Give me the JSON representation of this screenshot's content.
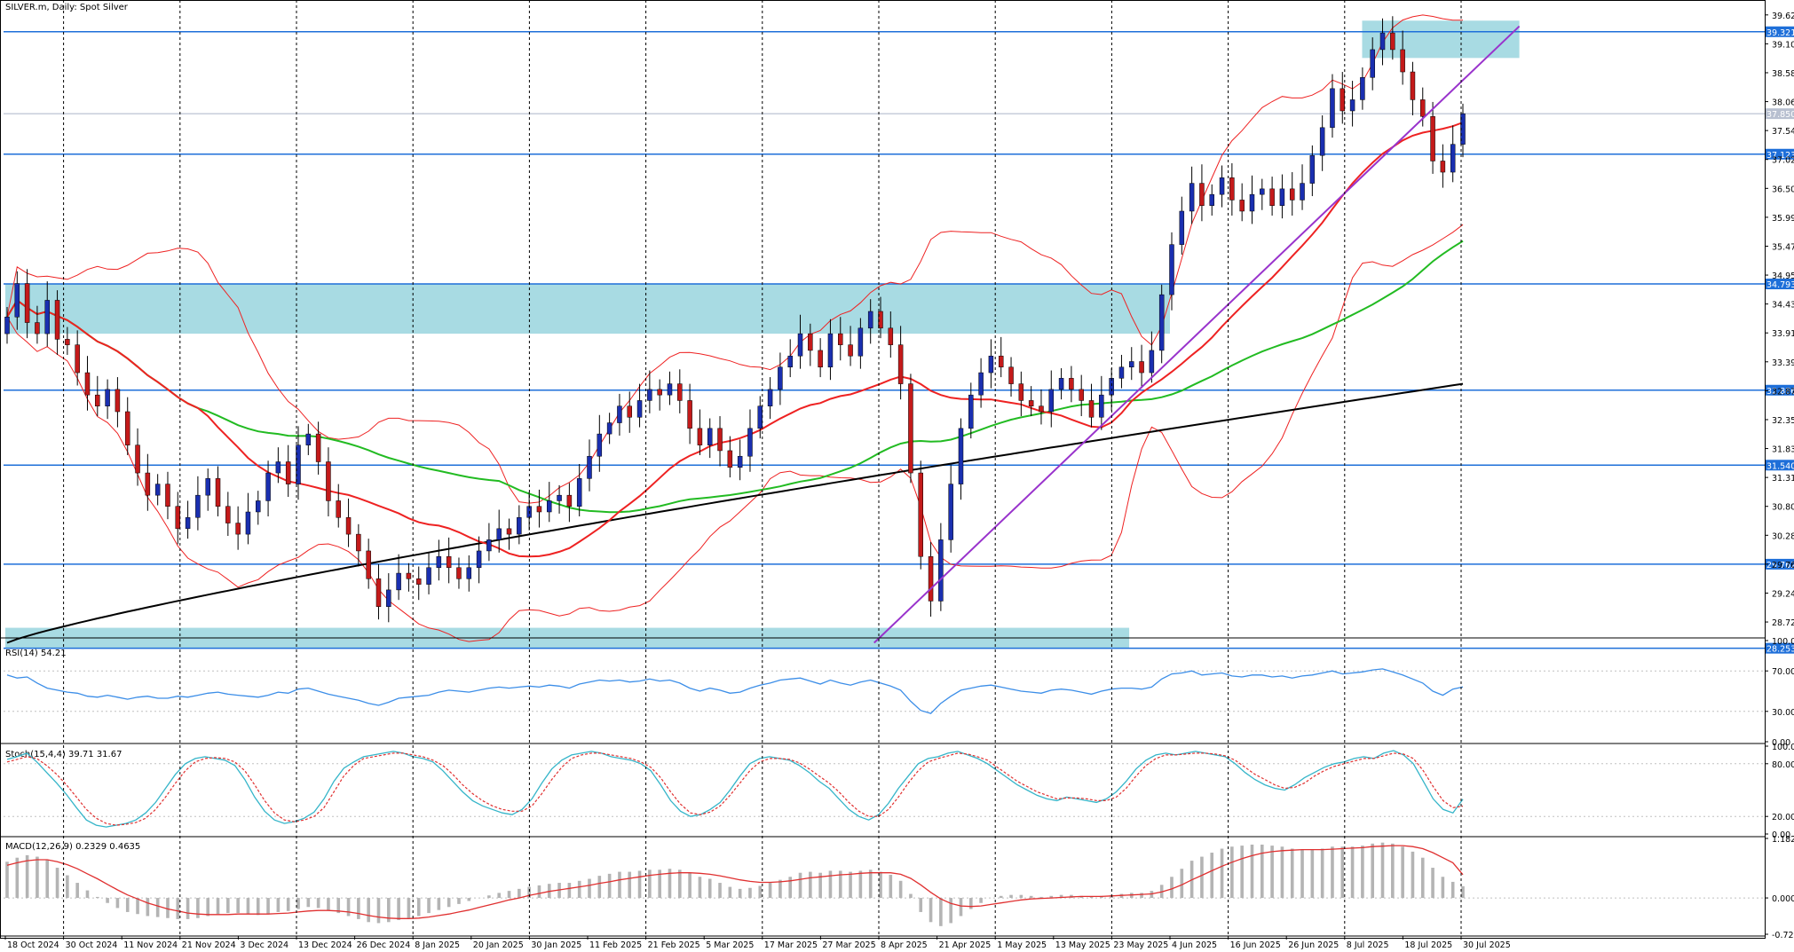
{
  "chart_data": {
    "type": "candlestick",
    "symbol_title": "SILVER.m, Daily: Spot Silver",
    "main_scale": {
      "ylim": [
        28.47,
        39.62
      ],
      "ticks": [
        "39.623",
        "39.104",
        "38.585",
        "38.066",
        "37.547",
        "37.028",
        "36.509",
        "35.990",
        "35.471",
        "34.952",
        "34.433",
        "33.914",
        "33.395",
        "32.876",
        "32.357",
        "31.838",
        "31.319",
        "30.800",
        "30.281",
        "29.762",
        "29.243",
        "28.724"
      ]
    },
    "date_labels": [
      "18 Oct 2024",
      "30 Oct 2024",
      "11 Nov 2024",
      "21 Nov 2024",
      "3 Dec 2024",
      "13 Dec 2024",
      "26 Dec 2024",
      "8 Jan 2025",
      "20 Jan 2025",
      "30 Jan 2025",
      "11 Feb 2025",
      "21 Feb 2025",
      "5 Mar 2025",
      "17 Mar 2025",
      "27 Mar 2025",
      "8 Apr 2025",
      "21 Apr 2025",
      "1 May 2025",
      "13 May 2025",
      "23 May 2025",
      "4 Jun 2025",
      "16 Jun 2025",
      "26 Jun 2025",
      "8 Jul 2025",
      "18 Jul 2025",
      "30 Jul 2025"
    ],
    "current_price": {
      "value": 37.85,
      "label": "37.850"
    },
    "horizontal_levels": [
      {
        "value": 39.321,
        "label": "39.321"
      },
      {
        "value": 37.123,
        "label": "37.123"
      },
      {
        "value": 34.793,
        "label": "34.793"
      },
      {
        "value": 32.886,
        "label": "32.886"
      },
      {
        "value": 31.54,
        "label": "31.540"
      },
      {
        "value": 29.762,
        "label": "29.762"
      },
      {
        "value": 28.253,
        "label": "28.253"
      }
    ],
    "zones": [
      {
        "from_date": "18 Oct 2024",
        "to_date": "4 Jun 2025",
        "y_low": 33.9,
        "y_high": 34.79
      },
      {
        "from_date": "11 Jul 2025",
        "to_date": "8 Aug 2025",
        "y_low": 38.85,
        "y_high": 39.52
      },
      {
        "from_date": "18 Oct 2024",
        "to_date": "26 May 2025",
        "y_low": 28.25,
        "y_high": 28.62
      }
    ],
    "trendlines": [
      {
        "from_date": "7 Apr 2025",
        "from_value": 28.35,
        "to_date": "8 Aug 2025",
        "to_value": 39.42,
        "color": "#9933cc"
      }
    ],
    "series": [
      {
        "name": "Price",
        "type": "candlestick",
        "color_up": "#1a2fb0",
        "color_down": "#c41a1a"
      },
      {
        "name": "MA 20",
        "color": "#ee2222"
      },
      {
        "name": "MA 50",
        "color": "#22bb22"
      },
      {
        "name": "MA 200",
        "color": "#000000"
      },
      {
        "name": "Bollinger Bands",
        "color": "#ee2222"
      }
    ],
    "candles_close": [
      34.2,
      34.8,
      34.1,
      33.9,
      34.5,
      33.8,
      33.7,
      33.2,
      32.8,
      32.6,
      32.9,
      32.5,
      31.9,
      31.4,
      31.0,
      31.2,
      30.8,
      30.4,
      30.6,
      31.0,
      31.3,
      30.8,
      30.5,
      30.3,
      30.7,
      30.9,
      31.4,
      31.6,
      31.2,
      31.9,
      32.1,
      31.6,
      30.9,
      30.6,
      30.3,
      30.0,
      29.5,
      29.0,
      29.3,
      29.6,
      29.5,
      29.4,
      29.7,
      29.9,
      29.7,
      29.5,
      29.7,
      30.0,
      30.2,
      30.4,
      30.3,
      30.6,
      30.8,
      30.7,
      30.9,
      31.0,
      30.8,
      31.3,
      31.7,
      32.1,
      32.3,
      32.6,
      32.4,
      32.7,
      32.9,
      32.8,
      33.0,
      32.7,
      32.2,
      31.9,
      32.2,
      31.8,
      31.5,
      31.7,
      32.2,
      32.6,
      32.9,
      33.3,
      33.5,
      33.9,
      33.6,
      33.3,
      33.9,
      33.7,
      33.5,
      34.0,
      34.3,
      34.0,
      33.7,
      33.0,
      31.4,
      29.9,
      29.1,
      30.2,
      31.2,
      32.2,
      32.8,
      33.2,
      33.5,
      33.3,
      33.0,
      32.7,
      32.6,
      32.5,
      32.9,
      33.1,
      32.9,
      32.7,
      32.4,
      32.8,
      33.1,
      33.3,
      33.4,
      33.2,
      33.6,
      34.6,
      35.5,
      36.1,
      36.6,
      36.2,
      36.4,
      36.7,
      36.3,
      36.1,
      36.4,
      36.5,
      36.2,
      36.5,
      36.3,
      36.6,
      37.1,
      37.6,
      38.3,
      37.9,
      38.1,
      38.5,
      39.0,
      39.3,
      39.0,
      38.6,
      38.1,
      37.8,
      37.0,
      36.8,
      37.3,
      37.85
    ],
    "indicators": [
      {
        "name": "RSI(14)",
        "label": "RSI(14) 54.21",
        "value": 54.21,
        "ylim": [
          0,
          100
        ],
        "ticks": [
          "100.00",
          "70.00",
          "30.00",
          "0.00"
        ],
        "values": [
          66,
          63,
          64,
          58,
          53,
          51,
          49,
          48,
          45,
          44,
          46,
          44,
          42,
          44,
          45,
          43,
          43,
          45,
          44,
          46,
          48,
          49,
          47,
          46,
          45,
          44,
          46,
          49,
          48,
          52,
          53,
          50,
          47,
          45,
          43,
          41,
          38,
          36,
          39,
          43,
          44,
          45,
          46,
          49,
          51,
          50,
          49,
          51,
          53,
          54,
          53,
          54,
          55,
          54,
          56,
          55,
          53,
          57,
          59,
          61,
          60,
          61,
          59,
          60,
          62,
          60,
          61,
          58,
          53,
          50,
          53,
          51,
          48,
          49,
          53,
          56,
          58,
          61,
          62,
          63,
          60,
          57,
          61,
          58,
          56,
          59,
          61,
          58,
          55,
          51,
          40,
          31,
          28,
          38,
          45,
          51,
          53,
          55,
          56,
          54,
          52,
          50,
          49,
          48,
          51,
          52,
          51,
          49,
          47,
          50,
          52,
          53,
          53,
          52,
          54,
          62,
          67,
          68,
          70,
          66,
          67,
          68,
          65,
          64,
          66,
          66,
          64,
          65,
          63,
          65,
          66,
          68,
          70,
          67,
          68,
          69,
          71,
          72,
          69,
          66,
          62,
          58,
          50,
          46,
          52,
          54.21
        ]
      },
      {
        "name": "Stoch(15,4,4)",
        "label": "Stoch(15,4,4) 39.71 31.67",
        "ylim": [
          0,
          100
        ],
        "ticks": [
          "100.00",
          "80.00",
          "20.00",
          "0.00"
        ],
        "main": [
          85,
          88,
          92,
          82,
          70,
          58,
          45,
          30,
          16,
          10,
          8,
          10,
          12,
          16,
          24,
          36,
          52,
          68,
          80,
          86,
          88,
          86,
          84,
          78,
          62,
          42,
          26,
          16,
          12,
          14,
          18,
          25,
          40,
          60,
          75,
          82,
          88,
          90,
          92,
          94,
          92,
          88,
          86,
          82,
          72,
          60,
          48,
          38,
          32,
          28,
          24,
          22,
          28,
          40,
          58,
          74,
          84,
          90,
          92,
          94,
          92,
          88,
          86,
          84,
          80,
          72,
          56,
          38,
          26,
          20,
          22,
          28,
          36,
          50,
          66,
          80,
          86,
          88,
          86,
          84,
          78,
          70,
          60,
          52,
          40,
          28,
          20,
          16,
          22,
          35,
          52,
          66,
          80,
          86,
          88,
          92,
          94,
          90,
          86,
          80,
          72,
          64,
          56,
          50,
          44,
          40,
          38,
          42,
          40,
          38,
          36,
          40,
          48,
          60,
          74,
          84,
          90,
          92,
          90,
          92,
          94,
          92,
          90,
          88,
          80,
          70,
          62,
          56,
          52,
          50,
          56,
          64,
          70,
          76,
          80,
          82,
          86,
          88,
          86,
          92,
          95,
          90,
          80,
          60,
          40,
          28,
          24,
          39.71
        ],
        "signal": [
          82,
          85,
          88,
          86,
          78,
          68,
          56,
          42,
          28,
          18,
          12,
          10,
          11,
          13,
          18,
          28,
          42,
          58,
          72,
          82,
          86,
          87,
          86,
          82,
          72,
          56,
          38,
          24,
          16,
          14,
          16,
          20,
          30,
          48,
          66,
          78,
          86,
          88,
          90,
          92,
          92,
          90,
          88,
          84,
          78,
          68,
          56,
          46,
          38,
          32,
          28,
          26,
          26,
          32,
          46,
          62,
          76,
          86,
          90,
          92,
          92,
          90,
          88,
          86,
          82,
          76,
          64,
          48,
          34,
          24,
          22,
          25,
          32,
          44,
          58,
          72,
          82,
          86,
          86,
          85,
          81,
          74,
          66,
          58,
          48,
          36,
          26,
          20,
          20,
          28,
          42,
          58,
          72,
          82,
          86,
          89,
          92,
          91,
          88,
          84,
          76,
          68,
          60,
          54,
          48,
          44,
          40,
          41,
          41,
          40,
          38,
          38,
          42,
          52,
          66,
          78,
          86,
          90,
          90,
          91,
          92,
          92,
          91,
          89,
          84,
          76,
          68,
          62,
          56,
          52,
          53,
          58,
          66,
          72,
          77,
          80,
          83,
          86,
          86,
          89,
          92,
          91,
          86,
          72,
          54,
          38,
          30,
          31.67
        ]
      },
      {
        "name": "MACD(12,26,9)",
        "label": "MACD(12,26,9) 0.2329 0.4635",
        "ylim": [
          -0.7218,
          1.1828
        ],
        "ticks": [
          "1.1828",
          "0.0000",
          "-0.7218"
        ],
        "histogram": [
          0.72,
          0.8,
          0.85,
          0.82,
          0.75,
          0.6,
          0.45,
          0.3,
          0.15,
          0.02,
          -0.1,
          -0.2,
          -0.28,
          -0.32,
          -0.36,
          -0.38,
          -0.4,
          -0.42,
          -0.42,
          -0.4,
          -0.36,
          -0.32,
          -0.3,
          -0.3,
          -0.32,
          -0.34,
          -0.32,
          -0.28,
          -0.26,
          -0.22,
          -0.18,
          -0.2,
          -0.24,
          -0.3,
          -0.36,
          -0.42,
          -0.48,
          -0.5,
          -0.48,
          -0.44,
          -0.4,
          -0.36,
          -0.3,
          -0.24,
          -0.18,
          -0.12,
          -0.06,
          0.0,
          0.05,
          0.1,
          0.14,
          0.18,
          0.22,
          0.25,
          0.28,
          0.3,
          0.3,
          0.34,
          0.38,
          0.44,
          0.48,
          0.52,
          0.52,
          0.54,
          0.56,
          0.56,
          0.58,
          0.56,
          0.5,
          0.42,
          0.38,
          0.3,
          0.22,
          0.18,
          0.2,
          0.24,
          0.3,
          0.36,
          0.42,
          0.5,
          0.52,
          0.5,
          0.54,
          0.54,
          0.52,
          0.54,
          0.56,
          0.52,
          0.46,
          0.34,
          0.08,
          -0.28,
          -0.48,
          -0.56,
          -0.5,
          -0.36,
          -0.22,
          -0.1,
          0.0,
          0.04,
          0.06,
          0.06,
          0.04,
          0.02,
          0.04,
          0.06,
          0.06,
          0.04,
          0.02,
          0.04,
          0.06,
          0.08,
          0.1,
          0.1,
          0.14,
          0.26,
          0.42,
          0.58,
          0.74,
          0.82,
          0.9,
          0.98,
          1.02,
          1.04,
          1.06,
          1.06,
          1.04,
          1.02,
          0.98,
          0.96,
          0.96,
          0.98,
          1.02,
          1.02,
          1.02,
          1.04,
          1.08,
          1.1,
          1.08,
          1.02,
          0.92,
          0.8,
          0.6,
          0.42,
          0.32,
          0.2329
        ],
        "signal": [
          0.65,
          0.7,
          0.74,
          0.76,
          0.76,
          0.72,
          0.66,
          0.58,
          0.48,
          0.38,
          0.27,
          0.16,
          0.06,
          -0.02,
          -0.1,
          -0.16,
          -0.22,
          -0.26,
          -0.3,
          -0.32,
          -0.33,
          -0.33,
          -0.33,
          -0.32,
          -0.32,
          -0.32,
          -0.32,
          -0.31,
          -0.3,
          -0.28,
          -0.26,
          -0.25,
          -0.25,
          -0.26,
          -0.28,
          -0.31,
          -0.35,
          -0.38,
          -0.4,
          -0.41,
          -0.41,
          -0.4,
          -0.38,
          -0.35,
          -0.32,
          -0.28,
          -0.24,
          -0.19,
          -0.14,
          -0.09,
          -0.04,
          0.0,
          0.05,
          0.09,
          0.13,
          0.16,
          0.19,
          0.22,
          0.25,
          0.29,
          0.32,
          0.36,
          0.39,
          0.42,
          0.45,
          0.47,
          0.49,
          0.5,
          0.5,
          0.49,
          0.47,
          0.44,
          0.4,
          0.36,
          0.33,
          0.31,
          0.31,
          0.32,
          0.34,
          0.37,
          0.4,
          0.42,
          0.44,
          0.46,
          0.47,
          0.49,
          0.5,
          0.5,
          0.5,
          0.47,
          0.39,
          0.26,
          0.11,
          -0.02,
          -0.11,
          -0.16,
          -0.17,
          -0.16,
          -0.13,
          -0.1,
          -0.07,
          -0.04,
          -0.02,
          -0.01,
          0.0,
          0.01,
          0.02,
          0.03,
          0.03,
          0.03,
          0.04,
          0.05,
          0.06,
          0.07,
          0.08,
          0.12,
          0.18,
          0.26,
          0.36,
          0.45,
          0.54,
          0.63,
          0.71,
          0.78,
          0.84,
          0.89,
          0.92,
          0.94,
          0.95,
          0.96,
          0.96,
          0.96,
          0.97,
          0.98,
          0.99,
          1.0,
          1.02,
          1.03,
          1.04,
          1.04,
          1.02,
          0.98,
          0.9,
          0.8,
          0.7,
          0.4635
        ]
      }
    ],
    "colors": {
      "level_line": "#1e6fd9",
      "zone_fill": "#a8dbe3",
      "candle_up": "#1a2fb0",
      "candle_down": "#c41a1a",
      "ma20": "#ee2222",
      "ma50": "#22bb22",
      "ma200": "#000000",
      "bollinger": "#ee2222",
      "trendline": "#9933cc",
      "rsi": "#3c8ee8",
      "stoch_main": "#35b5c9",
      "stoch_signal": "#e03030",
      "macd_hist": "#b4b4b4",
      "macd_signal": "#e03030"
    }
  }
}
